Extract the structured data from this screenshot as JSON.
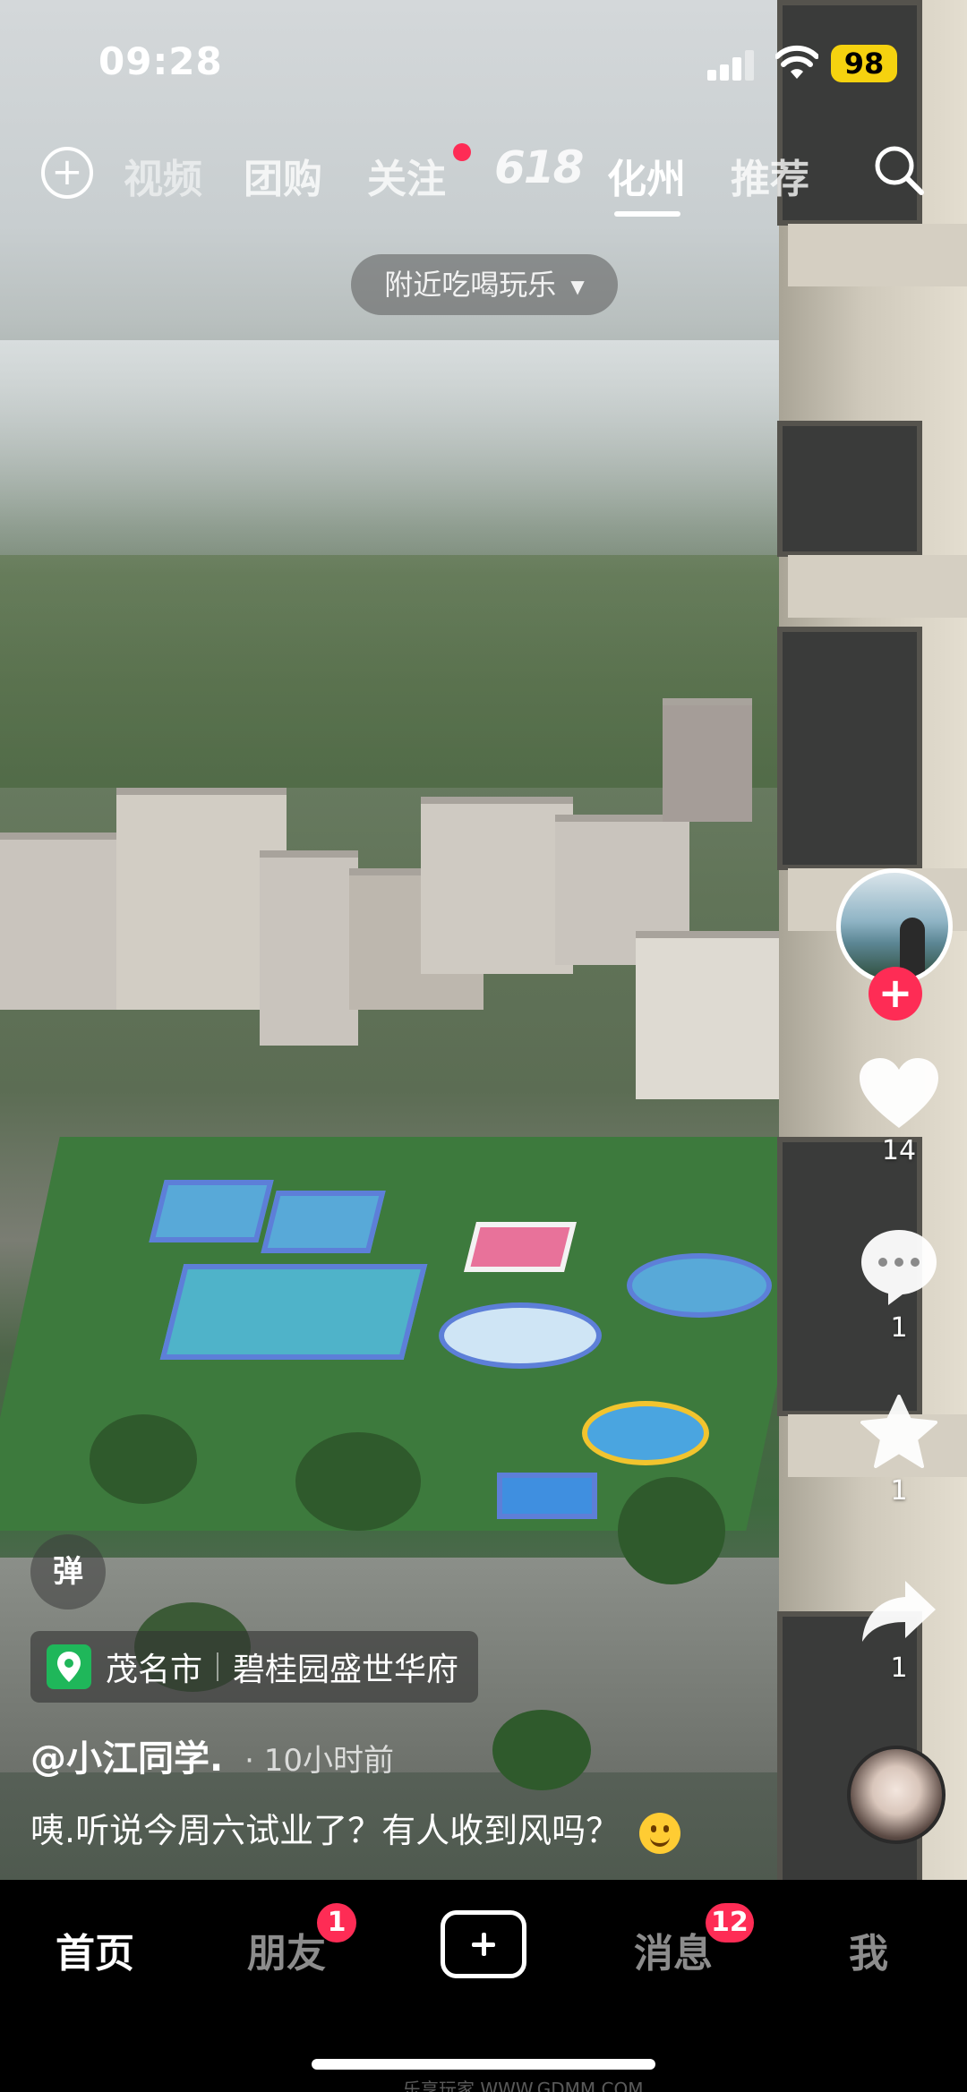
{
  "status_bar": {
    "time": "09:28",
    "battery": "98",
    "icons": [
      "signal-icon",
      "wifi-icon"
    ]
  },
  "top_nav": {
    "tabs": [
      {
        "label": "视频"
      },
      {
        "label": "团购"
      },
      {
        "label": "关注"
      },
      {
        "label": "618"
      },
      {
        "label": "化州"
      },
      {
        "label": "推荐"
      }
    ],
    "active_tab": "化州",
    "icons": [
      "add-circle-icon",
      "search-icon"
    ]
  },
  "nearby_pill": {
    "label": "附近吃喝玩乐",
    "icon": "caret-down-icon"
  },
  "right_rail": {
    "like_count": "14",
    "comment_count": "1",
    "favorite_count": "1",
    "share_count": "1",
    "accent": "#fe2c55"
  },
  "danmu": {
    "label": "弹"
  },
  "location": {
    "city": "茂名市",
    "place": "碧桂园盛世华府",
    "icon": "location-pin-icon",
    "icon_color": "#1fb75a"
  },
  "post": {
    "author": "@小江同学.",
    "time": "· 10小时前",
    "caption": "咦.听说今周六试业了？有人收到风吗？"
  },
  "bottom_nav": {
    "items": [
      {
        "label": "首页"
      },
      {
        "label": "朋友",
        "badge": "1"
      },
      {
        "label": "create"
      },
      {
        "label": "消息",
        "badge": "12"
      },
      {
        "label": "我"
      }
    ]
  },
  "watermark": "乐享玩家 WWW.GDMM.COM"
}
